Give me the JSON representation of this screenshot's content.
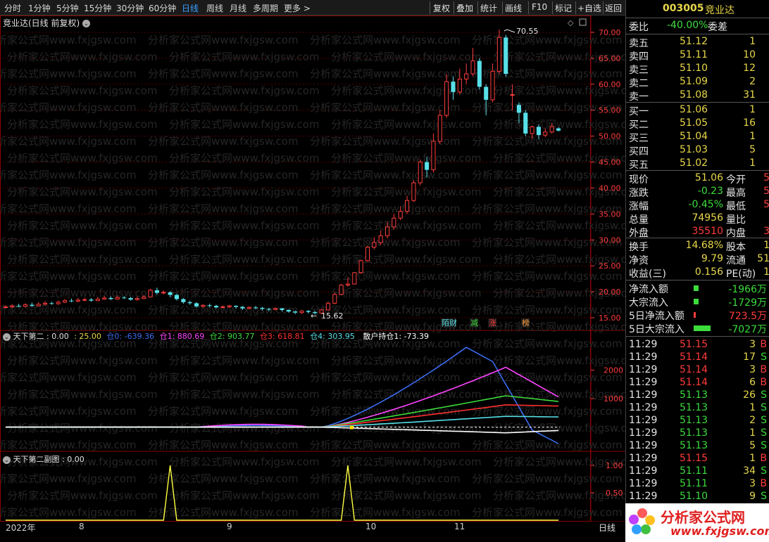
{
  "toolbar": {
    "periods": [
      "分时",
      "1分钟",
      "5分钟",
      "15分钟",
      "30分钟",
      "60分钟",
      "日线",
      "周线",
      "月线",
      "多周期",
      "更多 >"
    ],
    "active_period": "日线",
    "buttons": [
      "复权",
      "叠加",
      "统计",
      "画线",
      "F10",
      "标记",
      "+自选",
      "返回"
    ]
  },
  "chart": {
    "stock_title": "竞业达(日线 前复权)",
    "high_label": "70.55",
    "low_label": "15.62",
    "price_axis": [
      "70.00",
      "65.00",
      "60.00",
      "55.00",
      "50.00",
      "45.00",
      "40.00",
      "35.00",
      "30.00",
      "25.00",
      "20.00",
      "15.00"
    ],
    "event_tags": [
      "陌财",
      "减",
      "涨",
      "榜"
    ]
  },
  "indicator1": {
    "name": "天下第二",
    "value": "0.00",
    "p1": "25.00",
    "cang0": "仓0: -639.36",
    "cang1": "仓1: 880.69",
    "cang2": "仓2: 903.77",
    "cang3": "仓3: 618.81",
    "cang4": "仓4: 303.95",
    "retail": "散户持仓1: -73.39",
    "axis": [
      "2000",
      "1000"
    ]
  },
  "indicator2": {
    "name": "天下第二副图",
    "value": "0.00",
    "axis": [
      "1.00",
      "0.50"
    ]
  },
  "time_axis": [
    "2022年",
    "8",
    "9",
    "10",
    "11"
  ],
  "time_axis_right": "日线",
  "quote": {
    "code": "003005",
    "name": "竞业达",
    "weibi_label": "委比",
    "weibi": "-40.00%",
    "weicha_label": "委差",
    "asks": [
      {
        "label": "卖五",
        "price": "51.12",
        "vol": "1"
      },
      {
        "label": "卖四",
        "price": "51.11",
        "vol": "10"
      },
      {
        "label": "卖三",
        "price": "51.10",
        "vol": "12"
      },
      {
        "label": "卖二",
        "price": "51.09",
        "vol": "2"
      },
      {
        "label": "卖一",
        "price": "51.08",
        "vol": "31"
      }
    ],
    "bids": [
      {
        "label": "买一",
        "price": "51.06",
        "vol": "1"
      },
      {
        "label": "买二",
        "price": "51.05",
        "vol": "16"
      },
      {
        "label": "买三",
        "price": "51.04",
        "vol": "1"
      },
      {
        "label": "买四",
        "price": "51.03",
        "vol": "5"
      },
      {
        "label": "买五",
        "price": "51.02",
        "vol": "1"
      }
    ],
    "stats": [
      {
        "l1": "现价",
        "v1": "51.06",
        "l2": "今开",
        "v2": "5"
      },
      {
        "l1": "涨跌",
        "v1": "-0.23",
        "l2": "最高",
        "v2": "5"
      },
      {
        "l1": "涨幅",
        "v1": "-0.45%",
        "l2": "最低",
        "v2": "5"
      },
      {
        "l1": "总量",
        "v1": "74956",
        "l2": "量比",
        "v2": ""
      },
      {
        "l1": "外盘",
        "v1": "35510",
        "l2": "内盘",
        "v2": "3"
      }
    ],
    "stats2": [
      {
        "l1": "换手",
        "v1": "14.68%",
        "l2": "股本",
        "v2": "1"
      },
      {
        "l1": "净资",
        "v1": "9.79",
        "l2": "流通",
        "v2": "51"
      },
      {
        "l1": "收益(三)",
        "v1": "0.156",
        "l2": "PE(动)",
        "v2": "1"
      }
    ],
    "flows": [
      {
        "label": "净流入额",
        "value": "-1966万"
      },
      {
        "label": "大宗流入",
        "value": "-1729万"
      },
      {
        "label": "5日净流入额",
        "value": "723.5万"
      },
      {
        "label": "5日大宗流入",
        "value": "-7027万"
      }
    ],
    "ticks": [
      {
        "t": "11:29",
        "p": "51.15",
        "v": "3",
        "s": "B"
      },
      {
        "t": "11:29",
        "p": "51.14",
        "v": "17",
        "s": "S"
      },
      {
        "t": "11:29",
        "p": "51.14",
        "v": "3",
        "s": "B"
      },
      {
        "t": "11:29",
        "p": "51.14",
        "v": "6",
        "s": "B"
      },
      {
        "t": "11:29",
        "p": "51.13",
        "v": "26",
        "s": "S"
      },
      {
        "t": "11:29",
        "p": "51.13",
        "v": "1",
        "s": "S"
      },
      {
        "t": "11:29",
        "p": "51.13",
        "v": "2",
        "s": "S"
      },
      {
        "t": "11:29",
        "p": "51.13",
        "v": "1",
        "s": "S"
      },
      {
        "t": "11:29",
        "p": "51.13",
        "v": "5",
        "s": "S"
      },
      {
        "t": "11:29",
        "p": "51.15",
        "v": "1",
        "s": "B"
      },
      {
        "t": "11:29",
        "p": "51.11",
        "v": "34",
        "s": "S"
      },
      {
        "t": "11:29",
        "p": "51.11",
        "v": "3",
        "s": "B"
      },
      {
        "t": "11:29",
        "p": "51.10",
        "v": "9",
        "s": "S"
      }
    ]
  },
  "watermark": {
    "title": "分析家公式网",
    "url": "www.fxjgsw.com",
    "bg_text": "分析家公式网www.fxjgsw.com"
  },
  "colors": {
    "up": "#ff3c3c",
    "down": "#58e0e8",
    "grid": "#8b0000",
    "cang0": "#3a6cf0",
    "cang1": "#ff44ff",
    "cang2": "#3cdc3c",
    "cang3": "#ff3030",
    "cang4": "#58e0e8",
    "retail": "#ffffff"
  },
  "candles": [
    [
      17.0,
      17.1,
      17.4,
      16.8
    ],
    [
      17.1,
      17.3,
      17.6,
      16.9
    ],
    [
      17.3,
      17.2,
      17.7,
      17.0
    ],
    [
      17.2,
      17.5,
      17.8,
      17.0
    ],
    [
      17.5,
      17.3,
      17.9,
      17.1
    ],
    [
      17.3,
      17.6,
      18.0,
      17.2
    ],
    [
      17.6,
      17.8,
      18.2,
      17.4
    ],
    [
      17.8,
      17.7,
      18.1,
      17.5
    ],
    [
      17.7,
      18.0,
      18.3,
      17.5
    ],
    [
      18.0,
      18.3,
      18.6,
      17.8
    ],
    [
      18.3,
      18.2,
      18.7,
      18.0
    ],
    [
      18.2,
      18.4,
      18.8,
      18.0
    ],
    [
      18.4,
      18.5,
      18.9,
      18.2
    ],
    [
      18.5,
      18.3,
      18.8,
      18.1
    ],
    [
      18.3,
      18.6,
      19.0,
      18.2
    ],
    [
      18.6,
      18.8,
      19.2,
      18.5
    ],
    [
      18.8,
      18.6,
      19.1,
      18.4
    ],
    [
      18.6,
      18.9,
      19.3,
      18.5
    ],
    [
      18.9,
      18.8,
      19.2,
      18.6
    ],
    [
      18.8,
      18.5,
      19.0,
      18.3
    ],
    [
      18.5,
      18.7,
      19.1,
      18.3
    ],
    [
      18.7,
      19.0,
      19.4,
      18.6
    ],
    [
      19.0,
      20.3,
      20.6,
      18.9
    ],
    [
      20.3,
      19.8,
      20.8,
      19.5
    ],
    [
      19.8,
      19.9,
      20.3,
      19.5
    ],
    [
      19.9,
      19.4,
      20.1,
      19.0
    ],
    [
      19.4,
      18.6,
      19.6,
      18.3
    ],
    [
      18.6,
      18.0,
      18.8,
      17.7
    ],
    [
      18.0,
      17.8,
      18.3,
      17.5
    ],
    [
      17.8,
      17.2,
      18.0,
      17.0
    ],
    [
      17.2,
      17.4,
      17.6,
      16.9
    ],
    [
      17.4,
      17.3,
      17.7,
      17.0
    ],
    [
      17.3,
      17.0,
      17.5,
      16.8
    ],
    [
      17.0,
      17.1,
      17.4,
      16.8
    ],
    [
      17.1,
      17.3,
      17.5,
      16.9
    ],
    [
      17.3,
      17.1,
      17.4,
      16.8
    ],
    [
      17.1,
      16.8,
      17.2,
      16.5
    ],
    [
      16.8,
      17.0,
      17.2,
      16.6
    ],
    [
      17.0,
      16.9,
      17.3,
      16.6
    ],
    [
      16.9,
      16.7,
      17.1,
      16.4
    ],
    [
      16.7,
      16.6,
      16.9,
      16.3
    ],
    [
      16.6,
      16.8,
      17.0,
      16.4
    ],
    [
      16.8,
      16.5,
      16.9,
      16.2
    ],
    [
      16.5,
      16.2,
      16.6,
      16.0
    ],
    [
      16.2,
      16.0,
      16.4,
      15.7
    ],
    [
      16.0,
      16.3,
      16.5,
      15.7
    ],
    [
      16.3,
      16.1,
      16.5,
      15.8
    ],
    [
      16.1,
      15.9,
      16.3,
      15.6
    ],
    [
      15.9,
      16.5,
      16.7,
      15.7
    ],
    [
      16.5,
      17.8,
      18.1,
      16.4
    ],
    [
      17.8,
      19.5,
      19.8,
      17.6
    ],
    [
      19.5,
      21.3,
      21.5,
      19.3
    ],
    [
      21.3,
      21.5,
      22.8,
      21.0
    ],
    [
      21.5,
      23.7,
      23.8,
      21.4
    ],
    [
      23.7,
      26.0,
      26.2,
      23.5
    ],
    [
      26.0,
      28.6,
      28.9,
      25.8
    ],
    [
      28.6,
      29.5,
      30.5,
      28.2
    ],
    [
      29.5,
      30.8,
      31.8,
      29.0
    ],
    [
      30.8,
      32.5,
      33.5,
      30.3
    ],
    [
      32.5,
      34.2,
      35.0,
      32.0
    ],
    [
      34.2,
      35.5,
      36.5,
      33.8
    ],
    [
      35.5,
      37.6,
      38.5,
      35.0
    ],
    [
      37.6,
      41.0,
      41.5,
      37.3
    ],
    [
      41.0,
      45.0,
      45.5,
      40.5
    ],
    [
      45.0,
      43.5,
      46.0,
      42.0
    ],
    [
      43.5,
      49.0,
      50.5,
      43.0
    ],
    [
      49.0,
      54.0,
      55.0,
      48.5
    ],
    [
      54.0,
      60.5,
      62.0,
      53.5
    ],
    [
      60.5,
      58.5,
      61.5,
      57.0
    ],
    [
      58.5,
      61.0,
      63.0,
      58.0
    ],
    [
      61.0,
      62.0,
      64.0,
      60.0
    ],
    [
      62.0,
      64.5,
      67.0,
      61.5
    ],
    [
      64.5,
      59.5,
      65.0,
      59.0
    ],
    [
      59.5,
      57.0,
      60.0,
      54.0
    ],
    [
      57.0,
      62.5,
      64.0,
      56.5
    ],
    [
      62.5,
      69.0,
      70.55,
      62.0
    ],
    [
      69.0,
      62.0,
      69.5,
      61.5
    ],
    [
      58.0,
      58.0,
      60.0,
      55.0
    ],
    [
      56.0,
      54.5,
      56.5,
      52.5
    ],
    [
      54.5,
      50.5,
      55.0,
      50.0
    ],
    [
      50.5,
      51.8,
      52.0,
      49.5
    ],
    [
      51.8,
      50.2,
      52.2,
      49.4
    ],
    [
      50.2,
      50.8,
      51.5,
      49.8
    ],
    [
      50.8,
      51.8,
      52.5,
      50.5
    ],
    [
      51.5,
      51.06,
      51.7,
      50.9
    ]
  ]
}
